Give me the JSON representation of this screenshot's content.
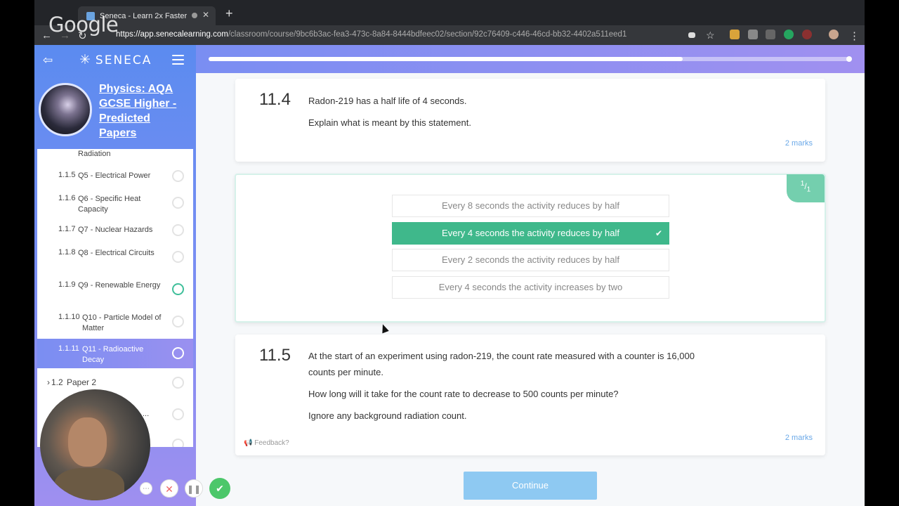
{
  "browser": {
    "tab_title": "Seneca - Learn 2x Faster",
    "url_host": "https://app.senecalearning.com",
    "url_path": "/classroom/course/9bc6b3ac-fea3-473c-8a84-8444bdfeec02/section/92c76409-c446-46cd-bb32-4402a511eed1",
    "watermark": "Google",
    "new_tab": "+",
    "tab_close": "✕"
  },
  "sidebar": {
    "logo": "SENECA",
    "course_title": "Physics: AQA GCSE Higher - Predicted Papers",
    "items": [
      {
        "num": "",
        "label": "Radiation"
      },
      {
        "num": "1.1.5",
        "label": "Q5 - Electrical Power"
      },
      {
        "num": "1.1.6",
        "label": "Q6 - Specific Heat Capacity"
      },
      {
        "num": "1.1.7",
        "label": "Q7 - Nuclear Hazards"
      },
      {
        "num": "1.1.8",
        "label": "Q8 - Electrical Circuits"
      },
      {
        "num": "1.1.9",
        "label": "Q9 - Renewable Energy"
      },
      {
        "num": "1.1.10",
        "label": "Q10 - Particle Model of Matter"
      },
      {
        "num": "1.1.11",
        "label": "Q11 - Radioactive Decay"
      },
      {
        "num": "1.2",
        "label": "Paper 2"
      },
      {
        "num": "",
        "label": "..."
      }
    ]
  },
  "progress": 0.74,
  "q1": {
    "number": "11.4",
    "line1": "Radon-219 has a half life of 4 seconds.",
    "line2": "Explain what is meant by this statement.",
    "marks": "2 marks"
  },
  "answers": {
    "badge_num": "1",
    "badge_den": "1",
    "options": [
      "Every 8 seconds the activity reduces by half",
      "Every 4 seconds the activity reduces by half",
      "Every 2 seconds the activity reduces by half",
      "Every 4 seconds the activity increases by two"
    ],
    "correct_index": 1
  },
  "q2": {
    "number": "11.5",
    "line1": "At the start of an experiment using radon-219, the count rate measured with a counter is 16,000",
    "line1b": "counts per minute.",
    "line2": "How long will it take for the count rate to decrease to 500 counts per minute?",
    "line3": "Ignore any background radiation count.",
    "marks": "2 marks",
    "feedback": "Feedback?"
  },
  "continue_label": "Continue",
  "colors": {
    "accent": "#7a8ef2",
    "correct": "#3fb88b",
    "badge": "#74cfae",
    "marks": "#6aa8e8",
    "continue": "#8ec9f2"
  }
}
